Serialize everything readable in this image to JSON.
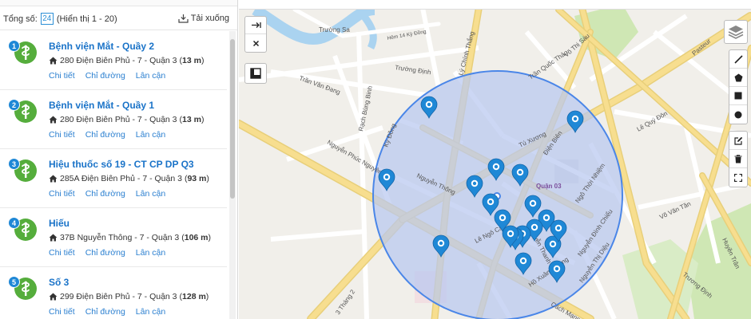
{
  "summary": {
    "total_label": "Tổng số:",
    "total_count": "24",
    "range_label": "(Hiển thị 1 - 20)",
    "download_label": "Tải xuống"
  },
  "results": [
    {
      "num": "1",
      "name": "Bệnh viện Mắt - Quầy 2",
      "address": "280 Điện Biên Phủ - 7 - Quận 3",
      "distance": "13 m",
      "detail": "Chi tiết",
      "directions": "Chỉ đường",
      "nearby": "Lân cận"
    },
    {
      "num": "2",
      "name": "Bệnh viện Mắt - Quầy 1",
      "address": "280 Điện Biên Phủ - 7 - Quận 3",
      "distance": "13 m",
      "detail": "Chi tiết",
      "directions": "Chỉ đường",
      "nearby": "Lân cận"
    },
    {
      "num": "3",
      "name": "Hiệu thuốc số 19 - CT CP DP Q3",
      "address": "285A Điện Biên Phủ - 7 - Quận 3",
      "distance": "93 m",
      "detail": "Chi tiết",
      "directions": "Chỉ đường",
      "nearby": "Lân cận"
    },
    {
      "num": "4",
      "name": "Hiếu",
      "address": "37B Nguyễn Thông - 7 - Quận 3",
      "distance": "106 m",
      "detail": "Chi tiết",
      "directions": "Chỉ đường",
      "nearby": "Lân cận"
    },
    {
      "num": "5",
      "name": "Số 3",
      "address": "299 Điện Biên Phủ - 7 - Quận 3",
      "distance": "128 m",
      "detail": "Chi tiết",
      "directions": "Chỉ đường",
      "nearby": "Lân cận"
    }
  ],
  "map": {
    "street_labels": [
      "Trường Sa",
      "Hẻm 14 Kỳ Đồng",
      "Lý Chính Thắng",
      "Trần Quốc Thảo",
      "Võ Thị Sáu",
      "Pasteur",
      "Trần Văn Đang",
      "Rạch Bùng Binh",
      "Trường Định",
      "Lê Quý Đôn",
      "Kỳ Đồng",
      "Nguyễn Phúc Nguyên",
      "Tú Xương",
      "Điện Biên",
      "Nguyễn Thông",
      "Ngô Thời Nhiệm",
      "Nguyễn Thanh Quan",
      "Võ Văn Tần",
      "Lê Ngô Cát",
      "Nguyễn Đình Chiểu",
      "Nguyễn Thị Diệu",
      "Hồ Xuân Hương",
      "3 Tháng 2",
      "Cách Mạng",
      "Trương Định",
      "Huyền Trân"
    ],
    "district_label": "Quận 03",
    "search_radius_m": 150,
    "accent_color": "#1f88d6",
    "circle_fill": "#b8c7f0",
    "pin_color": "#1f88d6",
    "pin_count": 19
  },
  "map_controls": {
    "left": [
      "arrow-right-bar-icon",
      "close-icon"
    ],
    "layer_toggle": "map-layer-icon",
    "layers": "layers-icon",
    "draw": [
      "draw-line-icon",
      "draw-polygon-icon",
      "draw-rectangle-icon",
      "draw-circle-icon"
    ],
    "edit": [
      "edit-icon",
      "delete-icon",
      "fullscreen-icon"
    ]
  }
}
